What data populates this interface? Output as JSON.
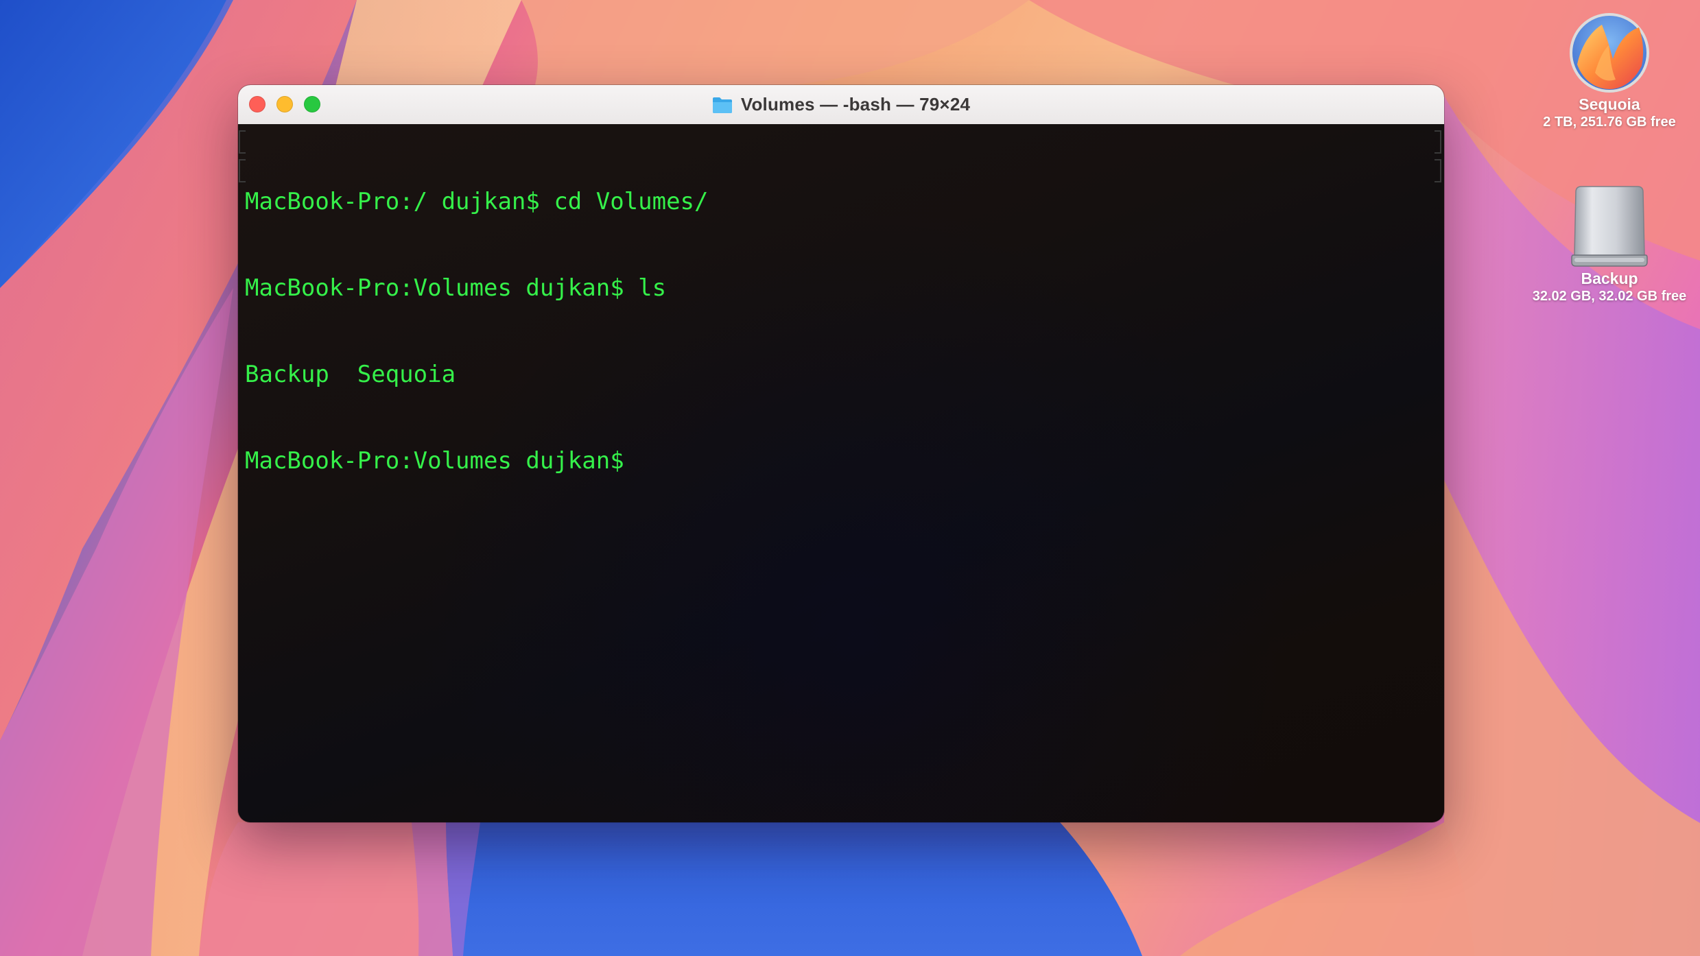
{
  "window": {
    "title": "Volumes — -bash — 79×24",
    "title_icon": "folder-icon"
  },
  "terminal": {
    "text_color": "#35f14a",
    "lines": [
      "MacBook-Pro:/ dujkan$ cd Volumes/",
      "MacBook-Pro:Volumes dujkan$ ls",
      "Backup  Sequoia",
      "MacBook-Pro:Volumes dujkan$"
    ]
  },
  "desktop": {
    "icons": [
      {
        "name": "Sequoia",
        "info": "2 TB, 251.76 GB free",
        "icon": "macos-sequoia-disk-icon"
      },
      {
        "name": "Backup",
        "info": "32.02 GB, 32.02 GB free",
        "icon": "external-drive-icon"
      }
    ]
  },
  "colors": {
    "close": "#fe5f57",
    "minimize": "#febc2e",
    "maximize": "#28c840"
  }
}
